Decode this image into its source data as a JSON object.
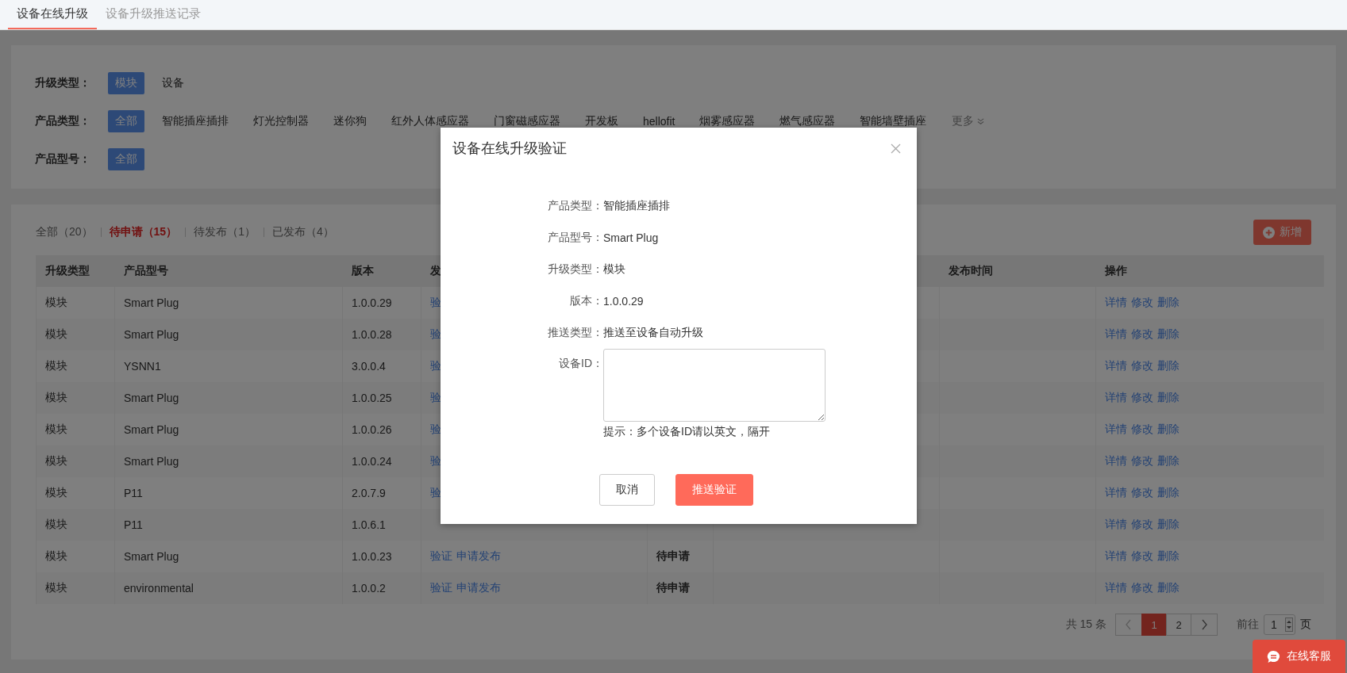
{
  "tabs": [
    {
      "label": "设备在线升级",
      "selected": true
    },
    {
      "label": "设备升级推送记录",
      "selected": false
    }
  ],
  "filters": [
    {
      "label": "升级类型：",
      "options": [
        {
          "label": "模块",
          "selected": true
        },
        {
          "label": "设备",
          "selected": false
        }
      ]
    },
    {
      "label": "产品类型：",
      "options": [
        {
          "label": "全部",
          "selected": true
        },
        {
          "label": "智能插座插排",
          "selected": false
        },
        {
          "label": "灯光控制器",
          "selected": false
        },
        {
          "label": "迷你狗",
          "selected": false
        },
        {
          "label": "红外人体感应器",
          "selected": false
        },
        {
          "label": "门窗磁感应器",
          "selected": false
        },
        {
          "label": "开发板",
          "selected": false
        },
        {
          "label": "hellofit",
          "selected": false
        },
        {
          "label": "烟雾感应器",
          "selected": false
        },
        {
          "label": "燃气感应器",
          "selected": false
        },
        {
          "label": "智能墙壁插座",
          "selected": false
        }
      ],
      "more": "更多"
    },
    {
      "label": "产品型号：",
      "options": [
        {
          "label": "全部",
          "selected": true
        }
      ]
    }
  ],
  "status_tabs": [
    {
      "label": "全部（20）",
      "selected": false
    },
    {
      "label": "待申请（15）",
      "selected": true
    },
    {
      "label": "待发布（1）",
      "selected": false
    },
    {
      "label": "已发布（4）",
      "selected": false
    }
  ],
  "add_button": "新增",
  "table": {
    "columns": [
      {
        "label": "升级类型"
      },
      {
        "label": "产品型号"
      },
      {
        "label": "版本"
      },
      {
        "label": "发"
      },
      {},
      {},
      {
        "label": "发布时间"
      },
      {
        "label": "操作"
      }
    ],
    "rows": [
      {
        "type": "模块",
        "model": "Smart Plug",
        "version": "1.0.0.29",
        "column_4": [
          "验"
        ],
        "actions": [
          "详情",
          "修改",
          "删除"
        ]
      },
      {
        "type": "模块",
        "model": "Smart Plug",
        "version": "1.0.0.28",
        "column_4": [
          "验"
        ],
        "actions": [
          "详情",
          "修改",
          "删除"
        ]
      },
      {
        "type": "模块",
        "model": "YSNN1",
        "version": "3.0.0.4",
        "column_4": [
          "验"
        ],
        "actions": [
          "详情",
          "修改",
          "删除"
        ]
      },
      {
        "type": "模块",
        "model": "Smart Plug",
        "version": "1.0.0.25",
        "column_4": [
          "验"
        ],
        "actions": [
          "详情",
          "修改",
          "删除"
        ]
      },
      {
        "type": "模块",
        "model": "Smart Plug",
        "version": "1.0.0.26",
        "column_4": [
          "验"
        ],
        "actions": [
          "详情",
          "修改",
          "删除"
        ]
      },
      {
        "type": "模块",
        "model": "Smart Plug",
        "version": "1.0.0.24",
        "column_4": [
          "验"
        ],
        "actions": [
          "详情",
          "修改",
          "删除"
        ]
      },
      {
        "type": "模块",
        "model": "P11",
        "version": "2.0.7.9",
        "column_4": [
          "验"
        ],
        "actions": [
          "详情",
          "修改",
          "删除"
        ]
      },
      {
        "type": "模块",
        "model": "P11",
        "version": "1.0.6.1",
        "actions": [
          "详情",
          "修改",
          "删除"
        ]
      },
      {
        "type": "模块",
        "model": "Smart Plug",
        "version": "1.0.0.23",
        "column_4": [
          "验证",
          "申请发布"
        ],
        "column_5": "待申请",
        "actions": [
          "详情",
          "修改",
          "删除"
        ]
      },
      {
        "type": "模块",
        "model": "environmental",
        "version": "1.0.0.2",
        "column_4": [
          "验证",
          "申请发布"
        ],
        "column_5": "待申请",
        "actions": [
          "详情",
          "修改",
          "删除"
        ]
      }
    ]
  },
  "pagination": {
    "total": "共 15 条",
    "pages": [
      {
        "label": "1",
        "selected": true
      },
      {
        "label": "2",
        "selected": false
      }
    ],
    "goto_label": "前往",
    "page_value": "1",
    "page_suffix": "页"
  },
  "dialog": {
    "title": "设备在线升级验证",
    "fields": [
      {
        "label": "产品类型：",
        "value": "智能插座插排"
      },
      {
        "label": "产品型号：",
        "value": "Smart Plug"
      },
      {
        "label": "升级类型：",
        "value": "模块"
      },
      {
        "label": "版本：",
        "value": "1.0.0.29"
      },
      {
        "label": "推送类型：",
        "value": "推送至设备自动升级"
      }
    ],
    "device_id_label": "设备ID：",
    "hint": "提示：多个设备ID请以英文，隔开",
    "buttons": [
      {
        "label": "取消",
        "kind": "secondary"
      },
      {
        "label": "推送验证",
        "kind": "primary"
      }
    ]
  },
  "chat_button": "在线客服"
}
